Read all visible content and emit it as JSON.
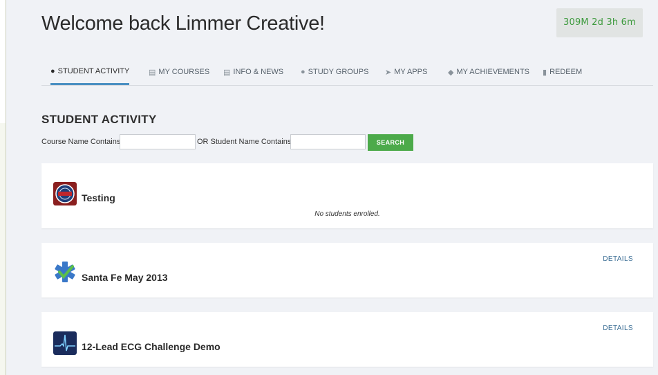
{
  "header": {
    "title": "Welcome back Limmer Creative!",
    "timer": "309M 2d 3h 6m"
  },
  "tabs": [
    {
      "label": "STUDENT ACTIVITY",
      "icon": "group-icon",
      "active": true
    },
    {
      "label": "MY COURSES",
      "icon": "briefcase-icon",
      "active": false
    },
    {
      "label": "INFO & NEWS",
      "icon": "newspaper-icon",
      "active": false
    },
    {
      "label": "STUDY GROUPS",
      "icon": "chat-icon",
      "active": false
    },
    {
      "label": "MY APPS",
      "icon": "tags-icon",
      "active": false
    },
    {
      "label": "MY ACHIEVEMENTS",
      "icon": "shield-icon",
      "active": false
    },
    {
      "label": "REDEEM",
      "icon": "barcode-icon",
      "active": false
    }
  ],
  "section": {
    "title": "STUDENT ACTIVITY",
    "course_label": "Course Name Contains",
    "course_value": "",
    "student_label": "OR Student Name Contains",
    "student_value": "",
    "search_label": "SEARCH"
  },
  "courses": [
    {
      "name": "Testing",
      "note": "No students enrolled.",
      "details": ""
    },
    {
      "name": "Santa Fe May 2013",
      "note": "",
      "details": "DETAILS"
    },
    {
      "name": "12-Lead ECG Challenge Demo",
      "note": "",
      "details": "DETAILS"
    }
  ],
  "colors": {
    "accent_tab": "#4a90c2",
    "search_button": "#4caa4a",
    "timer_text": "#3d9a3d",
    "details_link": "#3d6f96"
  }
}
